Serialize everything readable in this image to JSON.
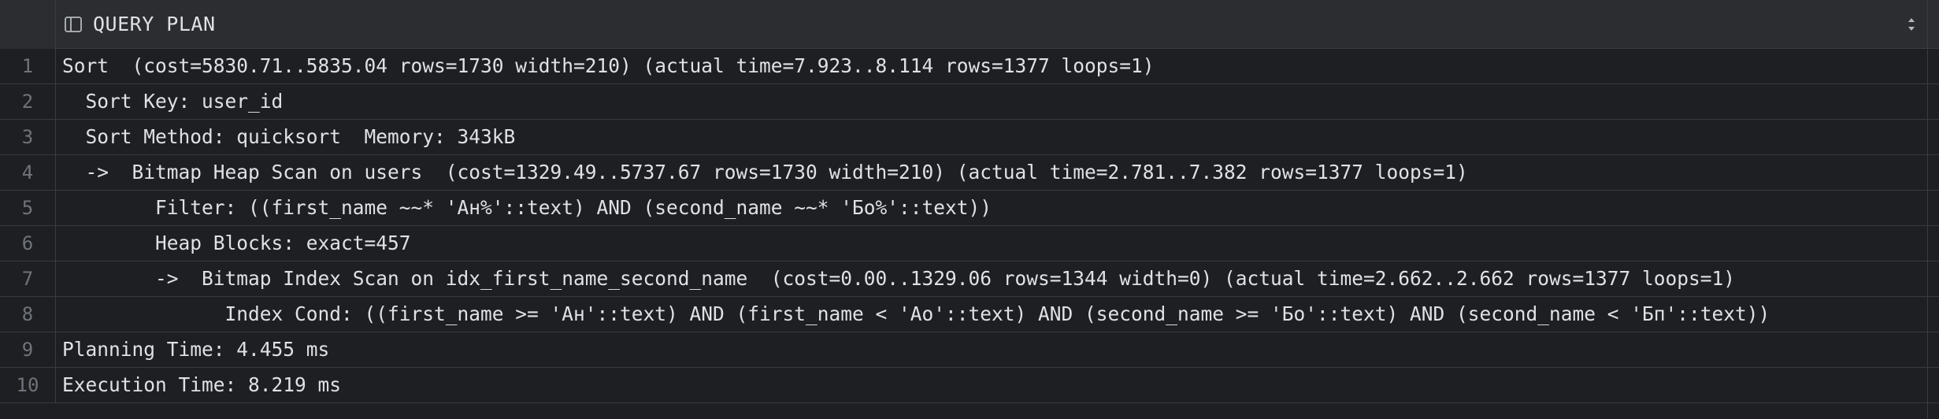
{
  "header": {
    "column_title": "QUERY PLAN",
    "column_icon": "table-column-icon",
    "sort_icon": "sort-updown-icon"
  },
  "colors": {
    "background": "#1e1f22",
    "header_background": "#2b2d30",
    "text": "#dfe1e5",
    "line_number": "#6f737a",
    "grid_line": "#393b3f"
  },
  "rows": [
    {
      "num": "1",
      "text": "Sort  (cost=5830.71..5835.04 rows=1730 width=210) (actual time=7.923..8.114 rows=1377 loops=1)"
    },
    {
      "num": "2",
      "text": "  Sort Key: user_id"
    },
    {
      "num": "3",
      "text": "  Sort Method: quicksort  Memory: 343kB"
    },
    {
      "num": "4",
      "text": "  ->  Bitmap Heap Scan on users  (cost=1329.49..5737.67 rows=1730 width=210) (actual time=2.781..7.382 rows=1377 loops=1)"
    },
    {
      "num": "5",
      "text": "        Filter: ((first_name ~~* 'Ан%'::text) AND (second_name ~~* 'Бо%'::text))"
    },
    {
      "num": "6",
      "text": "        Heap Blocks: exact=457"
    },
    {
      "num": "7",
      "text": "        ->  Bitmap Index Scan on idx_first_name_second_name  (cost=0.00..1329.06 rows=1344 width=0) (actual time=2.662..2.662 rows=1377 loops=1)"
    },
    {
      "num": "8",
      "text": "              Index Cond: ((first_name >= 'Ан'::text) AND (first_name < 'Ао'::text) AND (second_name >= 'Бо'::text) AND (second_name < 'Бп'::text))"
    },
    {
      "num": "9",
      "text": "Planning Time: 4.455 ms"
    },
    {
      "num": "10",
      "text": "Execution Time: 8.219 ms"
    }
  ]
}
